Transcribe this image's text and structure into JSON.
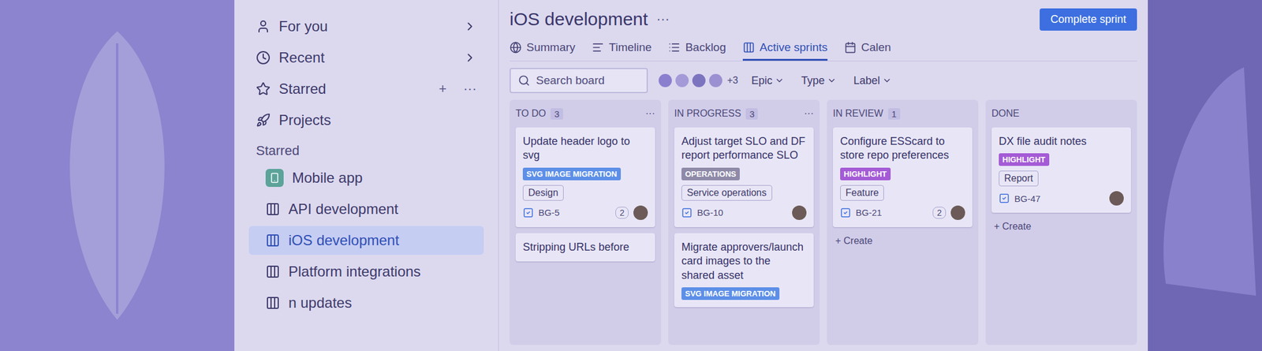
{
  "sidebar": {
    "nav": [
      {
        "label": "For you",
        "chevron": true
      },
      {
        "label": "Recent",
        "chevron": true
      },
      {
        "label": "Starred",
        "chevron": false,
        "actions": [
          "+",
          "···"
        ]
      },
      {
        "label": "Projects",
        "chevron": false
      }
    ],
    "section": "Starred",
    "projects": [
      {
        "label": "Mobile app",
        "kind": "app",
        "selected": false
      },
      {
        "label": "API development",
        "kind": "board",
        "selected": false
      },
      {
        "label": "iOS development",
        "kind": "board",
        "selected": true
      },
      {
        "label": "Platform integrations",
        "kind": "board",
        "selected": false
      },
      {
        "label": "n updates",
        "kind": "board",
        "selected": false
      }
    ]
  },
  "header": {
    "title": "iOS development",
    "more": "···",
    "button": "Complete sprint"
  },
  "tabs": [
    {
      "label": "Summary",
      "selected": false
    },
    {
      "label": "Timeline",
      "selected": false
    },
    {
      "label": "Backlog",
      "selected": false
    },
    {
      "label": "Active sprints",
      "selected": true
    },
    {
      "label": "Calen",
      "selected": false
    }
  ],
  "toolbar": {
    "search": {
      "placeholder": "Search board"
    },
    "avatars": [
      "#8a7fcf",
      "#a59ad8",
      "#7d74c0",
      "#9b91d2"
    ],
    "more_people": "+3",
    "filters": [
      "Epic",
      "Type",
      "Label"
    ]
  },
  "columns": [
    {
      "title": "TO DO",
      "count": "3",
      "more": "···",
      "create": "",
      "cards": [
        {
          "title": "Update header logo to svg",
          "tag": "SVG IMAGE MIGRATION",
          "color": "#5d8fe8",
          "label": "Design",
          "key": "BG-5",
          "points": "2",
          "done": true
        },
        {
          "title": "Stripping URLs before",
          "tag": "",
          "color": "#5d8fe8",
          "label": "",
          "key": "",
          "points": "",
          "done": false
        }
      ]
    },
    {
      "title": "IN PROGRESS",
      "count": "3",
      "more": "···",
      "create": "",
      "cards": [
        {
          "title": "Adjust target SLO and DF report performance SLO",
          "tag": "OPERATIONS",
          "color": "#8e8aa8",
          "label": "Service operations",
          "key": "BG-10",
          "points": "",
          "done": true
        },
        {
          "title": "Migrate approvers/launch card images to the shared asset",
          "tag": "SVG IMAGE MIGRATION",
          "color": "#5d8fe8",
          "label": "",
          "key": "",
          "points": "",
          "done": false
        }
      ]
    },
    {
      "title": "IN REVIEW",
      "count": "1",
      "more": "",
      "create": "+ Create",
      "cards": [
        {
          "title": "Configure ESScard to store repo preferences",
          "tag": "HIGHLIGHT",
          "color": "#a45bd6",
          "label": "Feature",
          "key": "BG-21",
          "points": "2",
          "done": true
        }
      ]
    },
    {
      "title": "DONE",
      "count": "",
      "more": "",
      "create": "+ Create",
      "cards": [
        {
          "title": "DX file audit notes",
          "tag": "HIGHLIGHT",
          "color": "#a45bd6",
          "label": "Report",
          "key": "BG-47",
          "points": "",
          "done": true
        }
      ]
    }
  ]
}
